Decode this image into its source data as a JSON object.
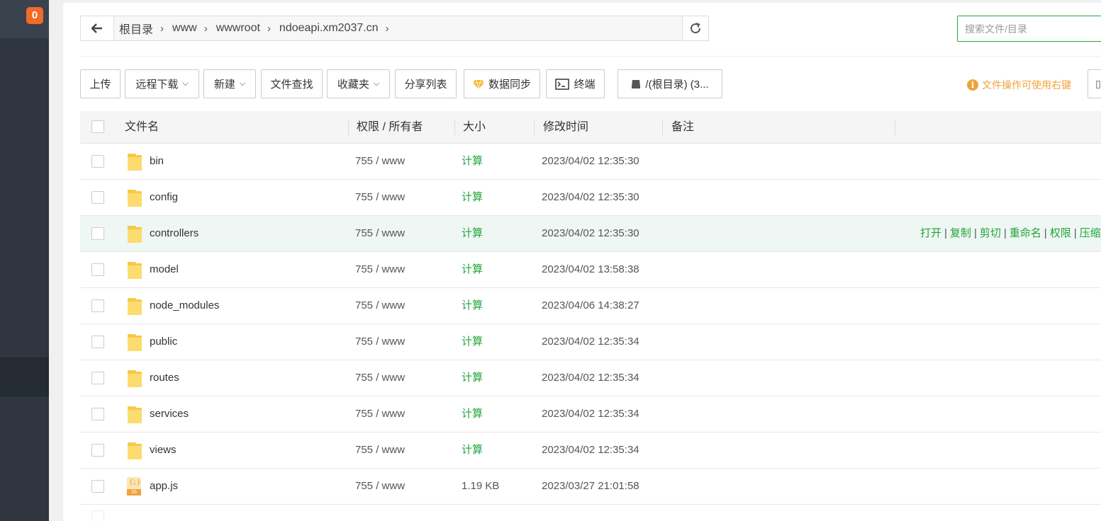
{
  "sidebar": {
    "badge_count": "0"
  },
  "breadcrumb": {
    "items": [
      "根目录",
      "www",
      "wwwroot",
      "ndoeapi.xm2037.cn"
    ]
  },
  "search": {
    "placeholder": "搜索文件/目录"
  },
  "toolbar": {
    "upload": "上传",
    "remote_download": "远程下载",
    "new": "新建",
    "find_file": "文件查找",
    "favorites": "收藏夹",
    "share_list": "分享列表",
    "data_sync": "数据同步",
    "terminal": "终端",
    "disk": "/(根目录) (3...",
    "hint": "文件操作可使用右键"
  },
  "table": {
    "headers": {
      "name": "文件名",
      "perm": "权限 / 所有者",
      "size": "大小",
      "mtime": "修改时间",
      "note": "备注"
    },
    "row_actions": [
      "打开",
      "复制",
      "剪切",
      "重命名",
      "权限",
      "压缩"
    ],
    "rows": [
      {
        "name": "bin",
        "type": "folder",
        "perm": "755 / www",
        "size": "计算",
        "mtime": "2023/04/02 12:35:30"
      },
      {
        "name": "config",
        "type": "folder",
        "perm": "755 / www",
        "size": "计算",
        "mtime": "2023/04/02 12:35:30"
      },
      {
        "name": "controllers",
        "type": "folder",
        "perm": "755 / www",
        "size": "计算",
        "mtime": "2023/04/02 12:35:30",
        "hovered": true
      },
      {
        "name": "model",
        "type": "folder",
        "perm": "755 / www",
        "size": "计算",
        "mtime": "2023/04/02 13:58:38"
      },
      {
        "name": "node_modules",
        "type": "folder",
        "perm": "755 / www",
        "size": "计算",
        "mtime": "2023/04/06 14:38:27"
      },
      {
        "name": "public",
        "type": "folder",
        "perm": "755 / www",
        "size": "计算",
        "mtime": "2023/04/02 12:35:34"
      },
      {
        "name": "routes",
        "type": "folder",
        "perm": "755 / www",
        "size": "计算",
        "mtime": "2023/04/02 12:35:34"
      },
      {
        "name": "services",
        "type": "folder",
        "perm": "755 / www",
        "size": "计算",
        "mtime": "2023/04/02 12:35:34"
      },
      {
        "name": "views",
        "type": "folder",
        "perm": "755 / www",
        "size": "计算",
        "mtime": "2023/04/02 12:35:34"
      },
      {
        "name": "app.js",
        "type": "js-file",
        "perm": "755 / www",
        "size": "1.19 KB",
        "mtime": "2023/03/27 21:01:58"
      }
    ]
  },
  "colors": {
    "accent": "#20a53a",
    "warning": "#f0a23c",
    "sidebar": "#2f3640",
    "badge": "#f06a2a"
  }
}
